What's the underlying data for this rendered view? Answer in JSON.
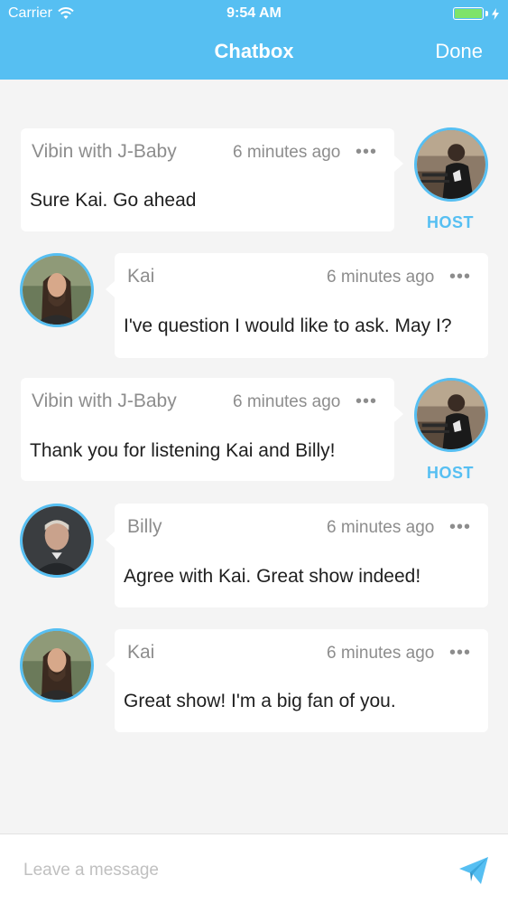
{
  "status_bar": {
    "carrier": "Carrier",
    "time": "9:54 AM",
    "battery_level": 1.0
  },
  "nav": {
    "title": "Chatbox",
    "done_label": "Done"
  },
  "messages": [
    {
      "sender": "Vibin with J-Baby",
      "time": "6 minutes ago",
      "text": "Sure Kai. Go ahead",
      "is_host": true,
      "host_label": "HOST",
      "avatar": "host-avatar"
    },
    {
      "sender": "Kai",
      "time": "6 minutes ago",
      "text": "I've question I would like to ask. May I?",
      "is_host": false,
      "avatar": "kai-avatar"
    },
    {
      "sender": "Vibin with J-Baby",
      "time": "6 minutes ago",
      "text": "Thank you for listening Kai and Billy!",
      "is_host": true,
      "host_label": "HOST",
      "avatar": "host-avatar"
    },
    {
      "sender": "Billy",
      "time": "6 minutes ago",
      "text": "Agree with Kai. Great show indeed!",
      "is_host": false,
      "avatar": "billy-avatar"
    },
    {
      "sender": "Kai",
      "time": "6 minutes ago",
      "text": "Great show! I'm a big fan of you.",
      "is_host": false,
      "avatar": "kai-avatar"
    }
  ],
  "composer": {
    "placeholder": "Leave a message",
    "value": ""
  },
  "more_glyph": "•••",
  "colors": {
    "accent": "#56bff2",
    "background": "#f4f4f4",
    "bubble": "#ffffff",
    "meta_text": "#8d8d8d",
    "battery": "#7ee36a"
  }
}
